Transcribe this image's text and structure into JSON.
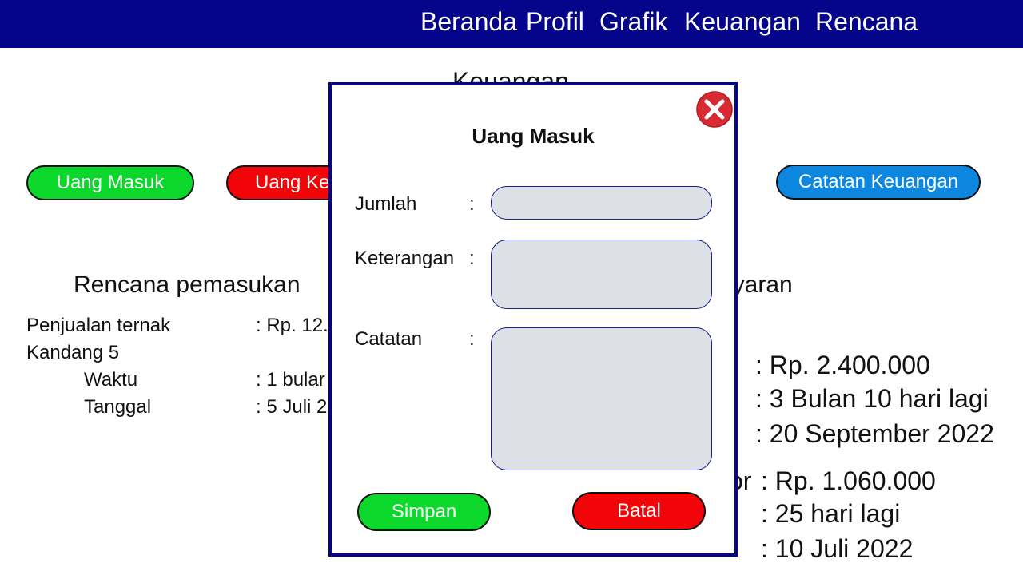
{
  "nav": {
    "items": [
      "Beranda",
      "Profil",
      "Grafik",
      "Keuangan",
      "Rencana"
    ]
  },
  "page": {
    "title": "Keuangan"
  },
  "actions": {
    "uang_masuk": "Uang Masuk",
    "uang_keluar": "Uang Ke",
    "catatan_keuangan": "Catatan Keuangan"
  },
  "rencana_pemasukan": {
    "heading": "Rencana pemasukan",
    "item_label": "Penjualan ternak",
    "item_value": ": Rp. 12.",
    "sub_label": "Kandang 5",
    "waktu_label": "Waktu",
    "waktu_value": ": 1 bular",
    "tanggal_label": "Tanggal",
    "tanggal_value": ": 5 Juli 2"
  },
  "rencana_pembayaran": {
    "heading_fragment": "ayaran",
    "item1": {
      "amount": ": Rp. 2.400.000",
      "waktu": ": 3 Bulan 10 hari lagi",
      "tanggal": ": 20 September 2022"
    },
    "item2": {
      "label_fragment": "or",
      "amount": ": Rp. 1.060.000",
      "waktu": ": 25 hari lagi",
      "tanggal": ": 10 Juli 2022"
    }
  },
  "modal": {
    "title": "Uang Masuk",
    "jumlah_label": "Jumlah",
    "keterangan_label": "Keterangan",
    "catatan_label": "Catatan",
    "colon": ":",
    "jumlah_value": "",
    "keterangan_value": "",
    "catatan_value": "",
    "save_label": "Simpan",
    "cancel_label": "Batal"
  },
  "colors": {
    "nav_bg": "#05058c",
    "green": "#0bd82a",
    "red": "#f20508",
    "blue": "#0d86e0",
    "field_bg": "#dde1e6",
    "close_red": "#d72a33"
  }
}
